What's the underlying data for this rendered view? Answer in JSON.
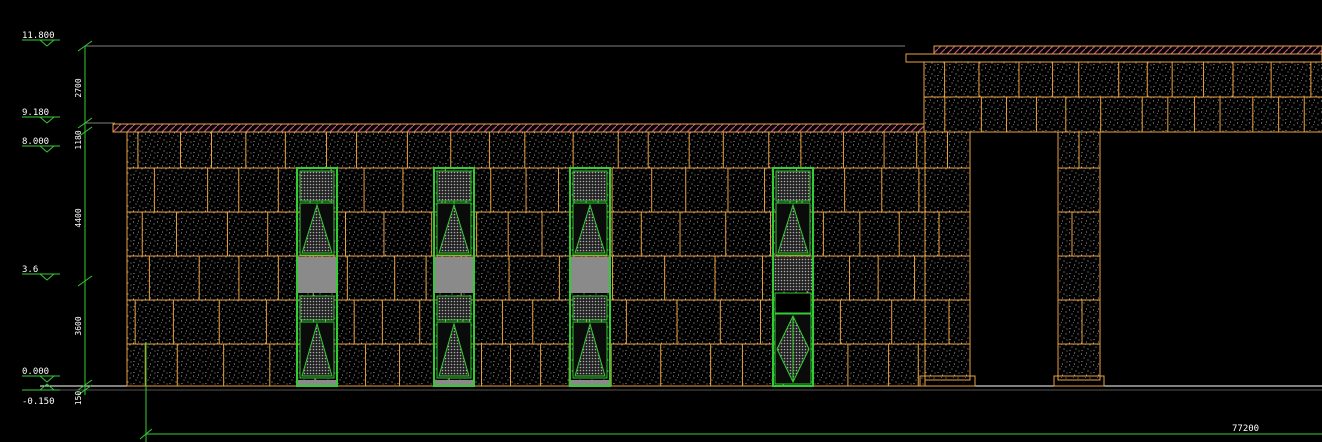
{
  "drawing": {
    "colors": {
      "background": "#000000",
      "block_lines": "#e8a23c",
      "window_frame": "#33cc33",
      "dimension_line": "#33cc33",
      "roof_hatch": "#c0508a",
      "glass_grey": "#8a8a8a",
      "text": "#ffffff",
      "stone_dots": "#d8d8d8"
    },
    "elevation_labels": [
      "11.800",
      "9.180",
      "8.000",
      "3.6",
      "0.000",
      "-0.150"
    ],
    "vertical_dimensions": [
      "2700",
      "1180",
      "4400",
      "3600",
      "150"
    ],
    "overall_dimension": "77200"
  }
}
